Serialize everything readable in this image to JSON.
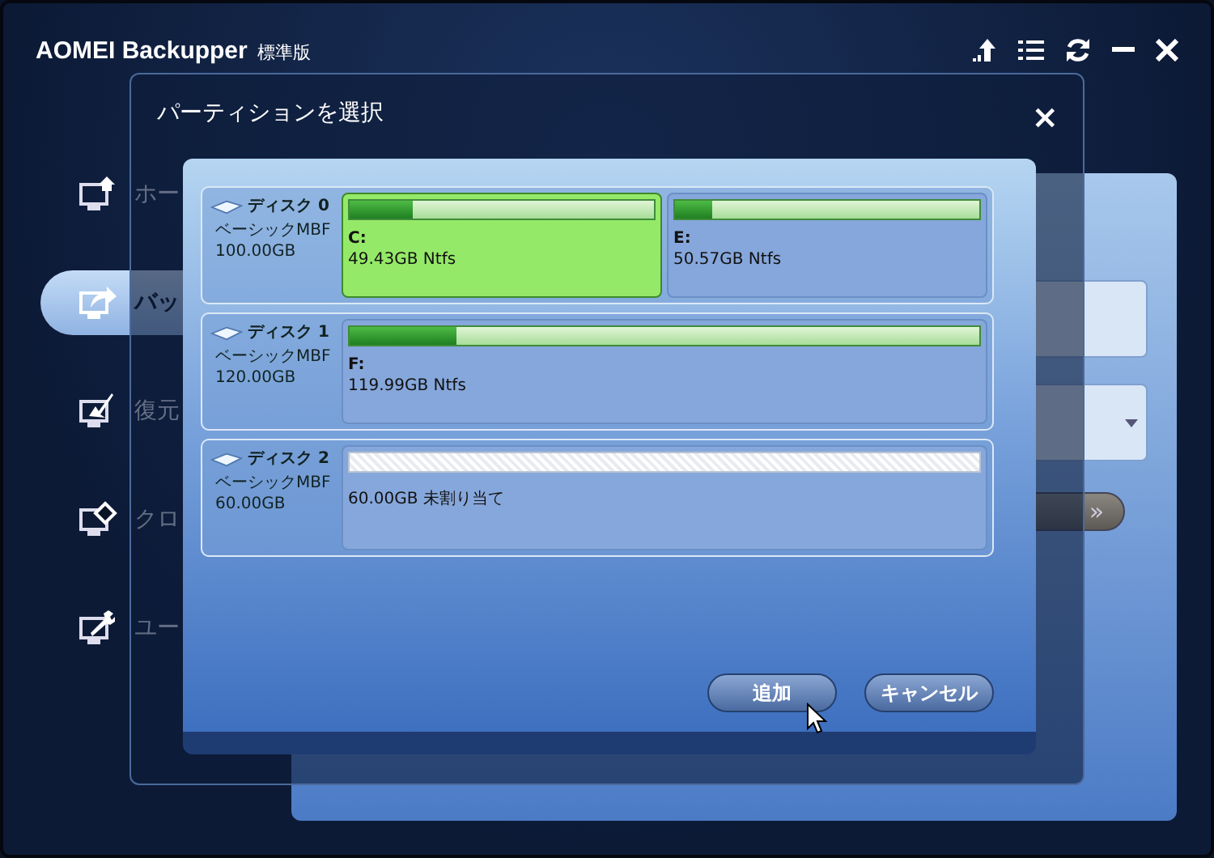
{
  "window": {
    "title": "AOMEI Backupper",
    "edition": "標準版"
  },
  "sidebar": {
    "items": [
      {
        "label": "ホー",
        "selected": false
      },
      {
        "label": "バッ",
        "selected": true
      },
      {
        "label": "復元",
        "selected": false
      },
      {
        "label": "クロ",
        "selected": false
      },
      {
        "label": "ユー",
        "selected": false
      }
    ]
  },
  "background_panel": {
    "next_button": "»"
  },
  "dialog": {
    "title": "パーティションを選択",
    "close": "×",
    "disks": [
      {
        "name": "ディスク 0",
        "type": "ベーシックMBF",
        "size": "100.00GB",
        "partitions": [
          {
            "kind": "partition",
            "letter": "C:",
            "info": "49.43GB Ntfs",
            "level": 0.21,
            "selected": true
          },
          {
            "kind": "partition",
            "letter": "E:",
            "info": "50.57GB Ntfs",
            "level": 0.12,
            "selected": false
          }
        ]
      },
      {
        "name": "ディスク 1",
        "type": "ベーシックMBF",
        "size": "120.00GB",
        "partitions": [
          {
            "kind": "partition",
            "letter": "F:",
            "info": "119.99GB Ntfs",
            "level": 0.17,
            "selected": false
          }
        ]
      },
      {
        "name": "ディスク 2",
        "type": "ベーシックMBF",
        "size": "60.00GB",
        "partitions": [
          {
            "kind": "unallocated",
            "info": "60.00GB 未割り当て",
            "selected": false
          }
        ]
      }
    ],
    "buttons": [
      {
        "label": "追加"
      },
      {
        "label": "キャンセル"
      }
    ]
  }
}
